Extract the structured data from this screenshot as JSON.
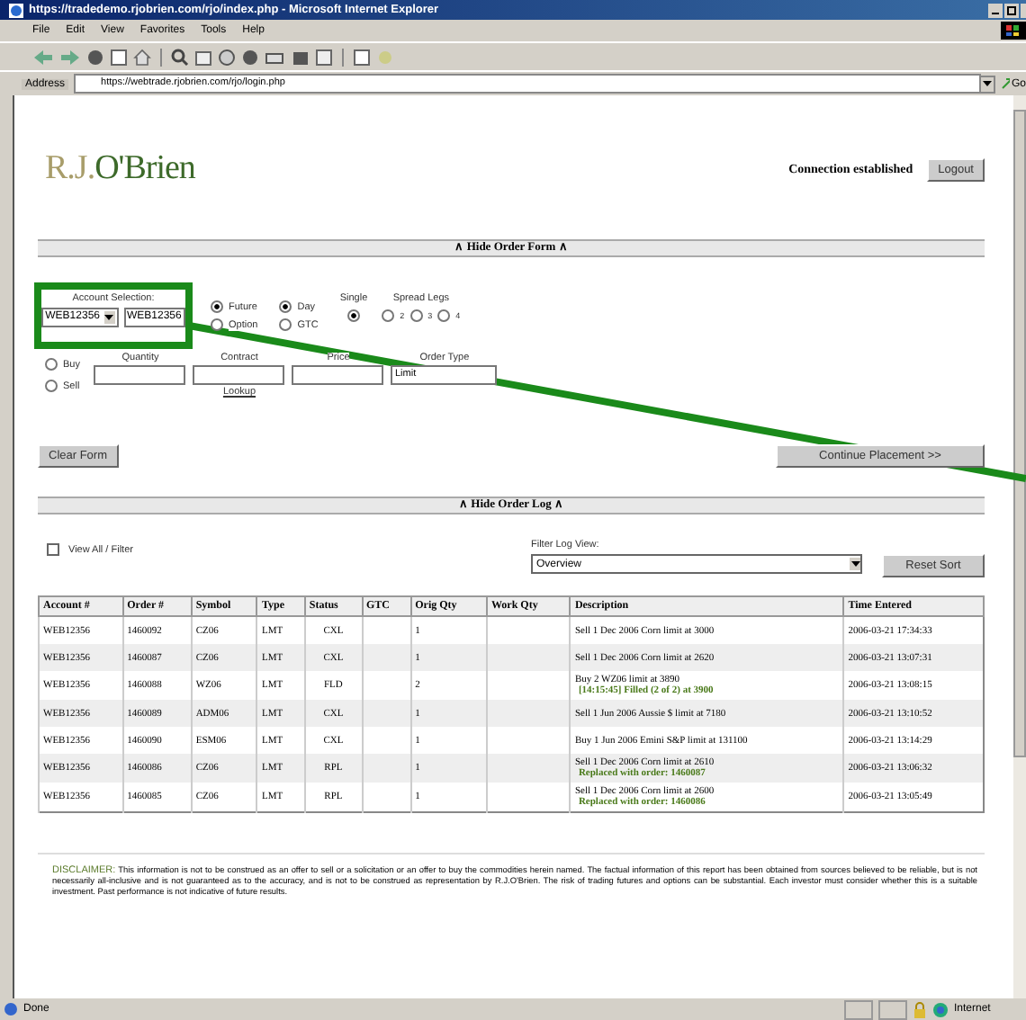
{
  "window": {
    "title": "https://tradedemo.rjobrien.com/rjo/index.php - Microsoft Internet Explorer"
  },
  "menu": [
    "File",
    "Edit",
    "View",
    "Favorites",
    "Tools",
    "Help"
  ],
  "address": {
    "label": "Address",
    "url": "https://webtrade.rjobrien.com/rjo/login.php",
    "go": "Go"
  },
  "header": {
    "logo_initials": "R.J.",
    "logo_name": "O'Brien",
    "connection": "Connection established",
    "logout": "Logout"
  },
  "order_form": {
    "toggle": "∧ Hide Order Form ∧",
    "account_label": "Account Selection:",
    "account_select": "WEB12356",
    "account_input": "WEB12356",
    "instrument": [
      {
        "label": "Future",
        "selected": true
      },
      {
        "label": "Option",
        "selected": false
      }
    ],
    "duration": [
      {
        "label": "Day",
        "selected": true
      },
      {
        "label": "GTC",
        "selected": false
      }
    ],
    "single": {
      "label": "Single",
      "selected": true
    },
    "spread": {
      "label": "Spread Legs",
      "options": [
        {
          "label": "2",
          "selected": false
        },
        {
          "label": "3",
          "selected": false
        },
        {
          "label": "4",
          "selected": false
        }
      ]
    },
    "side": [
      {
        "label": "Buy",
        "selected": false
      },
      {
        "label": "Sell",
        "selected": false
      }
    ],
    "fields": [
      {
        "label": "Quantity"
      },
      {
        "label": "Contract"
      },
      {
        "label": "Price"
      }
    ],
    "lookup": "Lookup",
    "order_type_label": "Order Type",
    "order_type": "Limit",
    "clear": "Clear Form",
    "continue": "Continue Placement >>"
  },
  "order_log": {
    "toggle": "∧ Hide Order Log ∧",
    "view_all": {
      "label": "View All / Filter",
      "checked": false
    },
    "filter_label": "Filter Log View:",
    "filter_value": "Overview",
    "reset": "Reset Sort",
    "columns": [
      "Account #",
      "Order #",
      "Symbol",
      "Type",
      "Status",
      "GTC",
      "Orig Qty",
      "Work Qty",
      "Description",
      "Time Entered"
    ],
    "rows": [
      {
        "account": "WEB12356",
        "order": "1460092",
        "symbol": "CZ06",
        "type": "LMT",
        "status": "CXL",
        "orig_qty": "1",
        "description": "Sell 1 Dec 2006 Corn limit at 3000",
        "time": "2006-03-21 17:34:33"
      },
      {
        "account": "WEB12356",
        "order": "1460087",
        "symbol": "CZ06",
        "type": "LMT",
        "status": "CXL",
        "orig_qty": "1",
        "description": "Sell 1 Dec 2006 Corn limit at 2620",
        "time": "2006-03-21 13:07:31"
      },
      {
        "account": "WEB12356",
        "order": "1460088",
        "symbol": "WZ06",
        "type": "LMT",
        "status": "FLD",
        "orig_qty": "2",
        "description": "Buy 2 WZ06 limit at 3890",
        "note": "[14:15:45]  Filled (2 of 2) at 3900",
        "time": "2006-03-21 13:08:15"
      },
      {
        "account": "WEB12356",
        "order": "1460089",
        "symbol": "ADM06",
        "type": "LMT",
        "status": "CXL",
        "orig_qty": "1",
        "description": "Sell 1 Jun 2006 Aussie $ limit at 7180",
        "time": "2006-03-21 13:10:52"
      },
      {
        "account": "WEB12356",
        "order": "1460090",
        "symbol": "ESM06",
        "type": "LMT",
        "status": "CXL",
        "orig_qty": "1",
        "description": "Buy 1 Jun 2006 Emini S&P limit at 131100",
        "time": "2006-03-21 13:14:29"
      },
      {
        "account": "WEB12356",
        "order": "1460086",
        "symbol": "CZ06",
        "type": "LMT",
        "status": "RPL",
        "orig_qty": "1",
        "description": "Sell 1 Dec 2006 Corn limit at 2610",
        "note": "Replaced with order: 1460087",
        "time": "2006-03-21 13:06:32"
      },
      {
        "account": "WEB12356",
        "order": "1460085",
        "symbol": "CZ06",
        "type": "LMT",
        "status": "RPL",
        "orig_qty": "1",
        "description": "Sell 1 Dec 2006 Corn limit at 2600",
        "note": "Replaced with order: 1460086",
        "time": "2006-03-21 13:05:49"
      }
    ]
  },
  "disclaimer": {
    "label": "DISCLAIMER:",
    "text": "This information is not to be construed as an offer to sell or a solicitation or an offer to buy the commodities herein named. The factual information of this report has been obtained from sources believed to be reliable, but is not necessarily all-inclusive and is not guaranteed as to the accuracy, and is not to be construed as representation by R.J.O'Brien. The risk of trading futures and options can be substantial. Each investor must consider whether this is a suitable investment. Past performance is not indicative of future results."
  },
  "status_bar": {
    "text": "Done",
    "zone": "Internet"
  }
}
